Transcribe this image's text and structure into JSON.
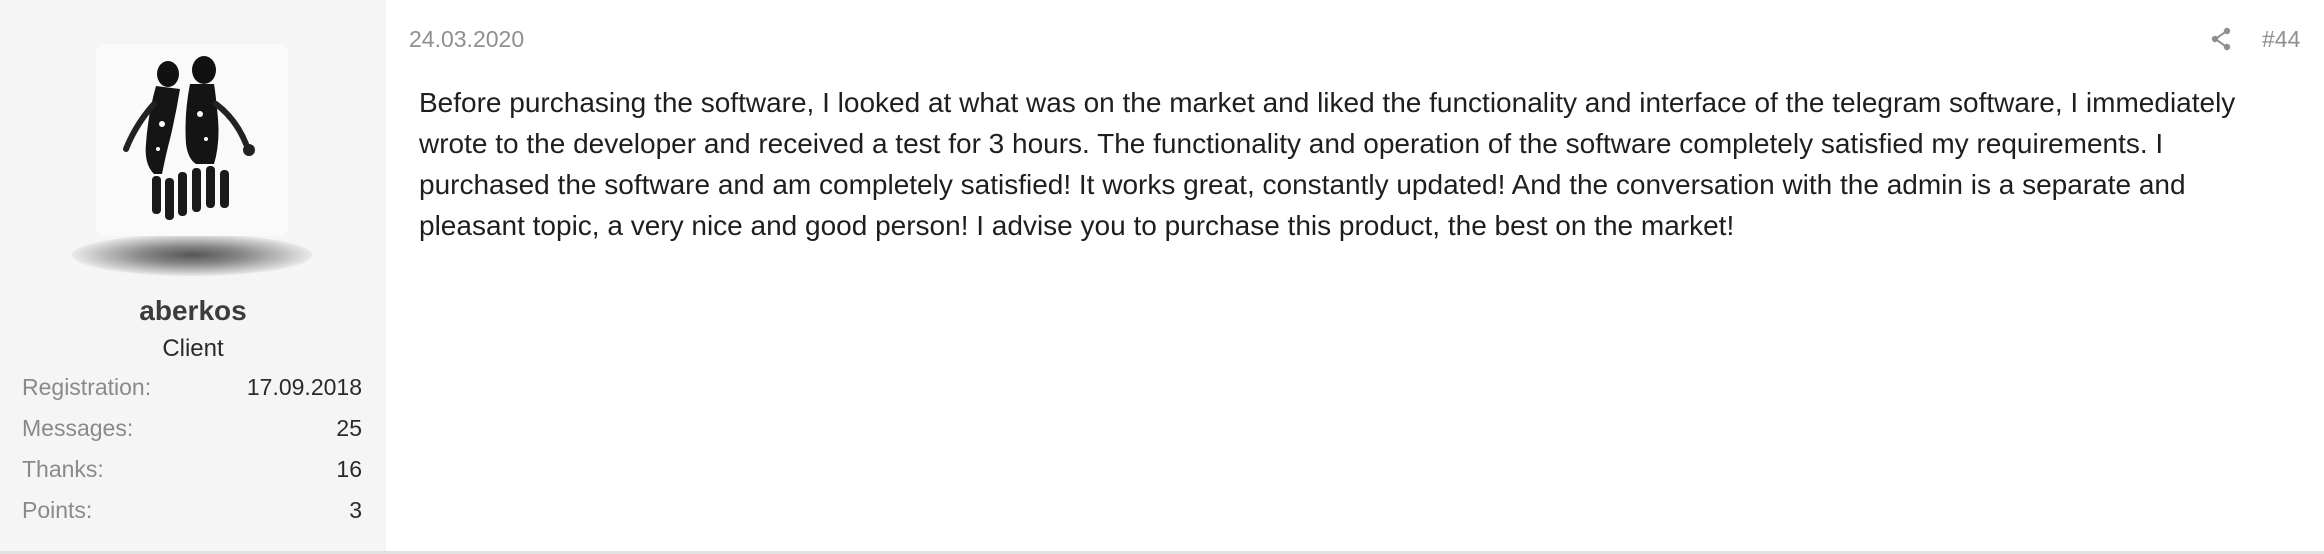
{
  "post": {
    "date": "24.03.2020",
    "number": "#44",
    "body": "Before purchasing the software, I looked at what was on the market and liked the functionality and interface of the telegram software, I immediately wrote to the developer and received a test for 3 hours. The functionality and operation of the software completely satisfied my requirements. I purchased the software and am completely satisfied! It works great, constantly updated! And the conversation with the admin is a separate and pleasant topic, a very nice and good person! I advise you to purchase this product, the best on the market!"
  },
  "user": {
    "name": "aberkos",
    "title": "Client",
    "avatar_icon": "handprint-figures-avatar",
    "stats": [
      {
        "label": "Registration:",
        "value": "17.09.2018"
      },
      {
        "label": "Messages:",
        "value": "25"
      },
      {
        "label": "Thanks:",
        "value": "16"
      },
      {
        "label": "Points:",
        "value": "3"
      }
    ]
  },
  "icons": {
    "share": "share-icon"
  },
  "colors": {
    "sidebar_bg": "#f5f5f5",
    "muted_text": "#8f8f8f",
    "body_text": "#1e1e1e"
  }
}
